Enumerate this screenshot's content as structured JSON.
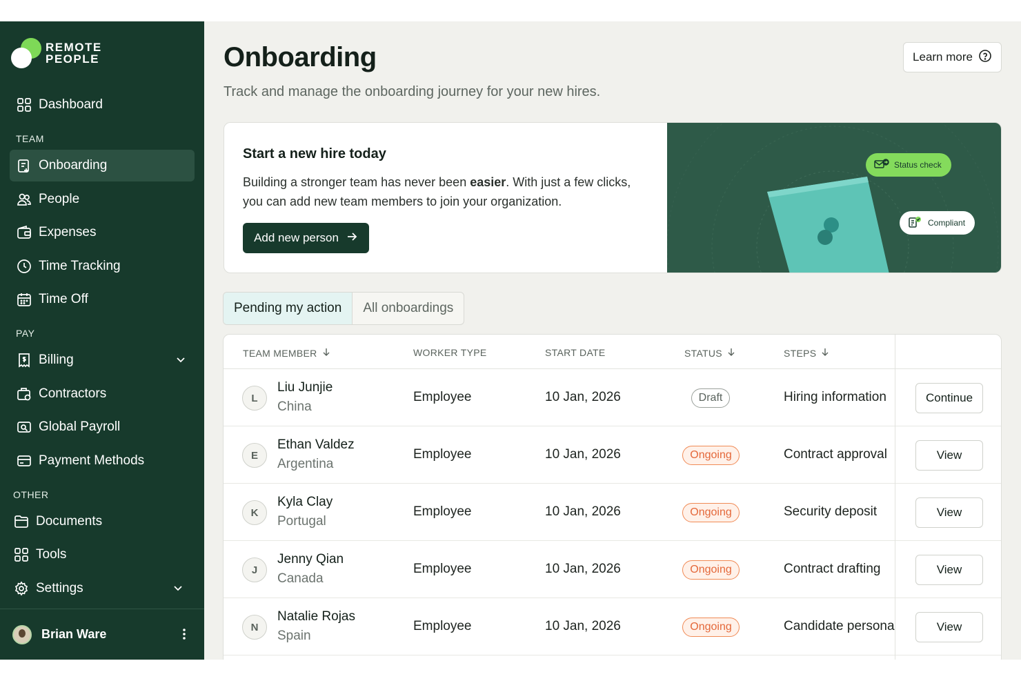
{
  "brand": {
    "name_line1": "REMOTE",
    "name_line2": "PEOPLE"
  },
  "sidebar": {
    "items": [
      {
        "label": "Dashboard",
        "icon": "grid-icon"
      },
      {
        "label": "Onboarding",
        "icon": "clipboard-add-icon",
        "active": true
      },
      {
        "label": "People",
        "icon": "people-icon"
      },
      {
        "label": "Expenses",
        "icon": "wallet-icon"
      },
      {
        "label": "Time Tracking",
        "icon": "clock-icon"
      },
      {
        "label": "Time Off",
        "icon": "calendar-icon"
      },
      {
        "label": "Billing",
        "icon": "receipt-icon"
      },
      {
        "label": "Contractors",
        "icon": "briefcase-icon"
      },
      {
        "label": "Global Payroll",
        "icon": "payroll-icon"
      },
      {
        "label": "Payment Methods",
        "icon": "card-icon"
      },
      {
        "label": "Documents",
        "icon": "folder-icon"
      },
      {
        "label": "Tools",
        "icon": "grid-icon"
      },
      {
        "label": "Settings",
        "icon": "gear-icon"
      }
    ],
    "sections": {
      "team": "TEAM",
      "pay": "PAY",
      "other": "OTHER"
    },
    "user": {
      "name": "Brian Ware"
    }
  },
  "header": {
    "title": "Onboarding",
    "subtitle": "Track and manage the onboarding journey for your new hires.",
    "learn_more": "Learn more"
  },
  "promo": {
    "title": "Start a new hire today",
    "body_pre": "Building a stronger team has never been ",
    "body_bold": "easier",
    "body_post": ". With just a few clicks, you can add new team members to join your organization.",
    "button": "Add new person",
    "pill_status": "Status check",
    "pill_compliant": "Compliant"
  },
  "tabs": [
    {
      "label": "Pending my action",
      "active": true
    },
    {
      "label": "All onboardings"
    }
  ],
  "table": {
    "columns": [
      "TEAM MEMBER",
      "WORKER TYPE",
      "START DATE",
      "STATUS",
      "STEPS"
    ],
    "rows": [
      {
        "initial": "L",
        "name": "Liu Junjie",
        "country": "China",
        "type": "Employee",
        "start": "10 Jan, 2026",
        "status": "Draft",
        "step": "Hiring information",
        "action": "Continue"
      },
      {
        "initial": "E",
        "name": "Ethan Valdez",
        "country": "Argentina",
        "type": "Employee",
        "start": "10 Jan, 2026",
        "status": "Ongoing",
        "step": "Contract approval",
        "action": "View"
      },
      {
        "initial": "K",
        "name": "Kyla Clay",
        "country": "Portugal",
        "type": "Employee",
        "start": "10 Jan, 2026",
        "status": "Ongoing",
        "step": "Security deposit",
        "action": "View"
      },
      {
        "initial": "J",
        "name": "Jenny Qian",
        "country": "Canada",
        "type": "Employee",
        "start": "10 Jan, 2026",
        "status": "Ongoing",
        "step": "Contract drafting",
        "action": "View"
      },
      {
        "initial": "N",
        "name": "Natalie Rojas",
        "country": "Spain",
        "type": "Employee",
        "start": "10 Jan, 2026",
        "status": "Ongoing",
        "step": "Candidate personal details",
        "action": "View"
      }
    ]
  },
  "colors": {
    "sidebar": "#173a2c",
    "accent_green": "#84db5c",
    "ongoing": "#e4683a"
  }
}
